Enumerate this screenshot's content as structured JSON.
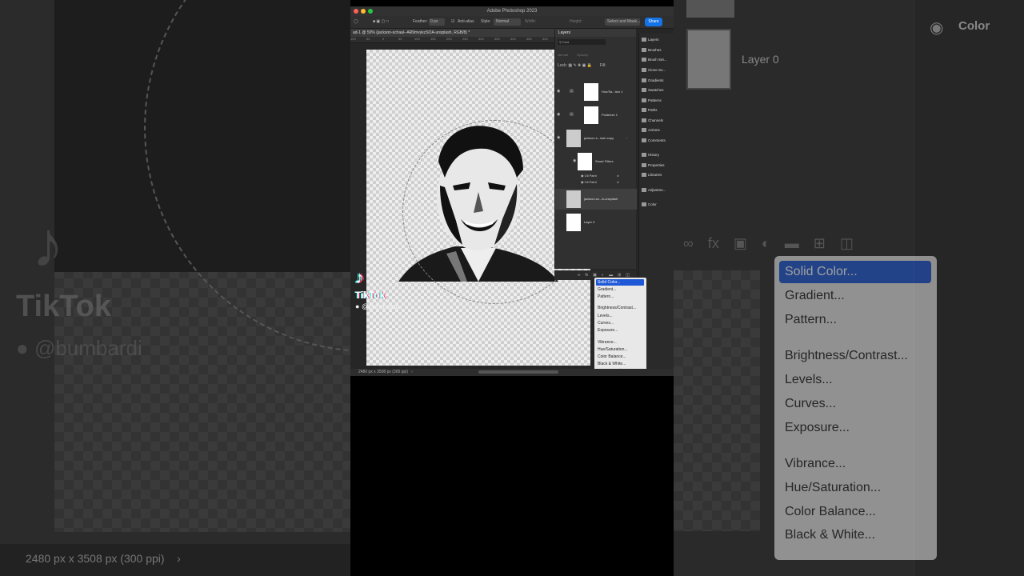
{
  "app": {
    "title": "Adobe Photoshop 2023",
    "doc_tab": "ad-1 @ 50% (jackson-schaal--AR9mvykzSOA-unsplash, RGB/8) *",
    "status": "2480 px x 3508 px (300 ppi)"
  },
  "options_bar": {
    "feather_label": "Feather:",
    "feather_value": "0 px",
    "anti_alias": "Anti-alias",
    "style_label": "Style:",
    "style_value": "Normal",
    "width_label": "Width:",
    "height_label": "Height:",
    "select_mask": "Select and Mask...",
    "share": "Share"
  },
  "ruler": [
    "100",
    "50",
    "0",
    "50",
    "100",
    "150",
    "200",
    "250",
    "300",
    "350",
    "400",
    "450",
    "500",
    "550"
  ],
  "layers_panel": {
    "title": "Layers",
    "filter": "Kind",
    "blend": "Normal",
    "opacity": "Opacity:",
    "lock": "Lock:",
    "fill": "Fill:",
    "layers": [
      {
        "name": "Hue/Sa...tion 1"
      },
      {
        "name": "Posterize 1"
      },
      {
        "name": "jackson-s...lash copy"
      },
      {
        "name": "Smart Filters"
      },
      {
        "name": "jackson-sc...A-unsplash"
      },
      {
        "name": "Layer 0"
      }
    ],
    "smart_filters": [
      "Oil Paint",
      "Oil Paint"
    ]
  },
  "side_panels": [
    "Layers",
    "Brushes",
    "Brush Set...",
    "Clone So...",
    "Gradients",
    "Swatches",
    "Patterns",
    "Paths",
    "Channels",
    "Actions",
    "Comments",
    "History",
    "Properties",
    "Libraries",
    "Adjustme...",
    "Color"
  ],
  "adjustment_menu": {
    "items": [
      "Solid Color...",
      "Gradient...",
      "Pattern...",
      "Brightness/Contrast...",
      "Levels...",
      "Curves...",
      "Exposure...",
      "Vibrance...",
      "Hue/Saturation...",
      "Color Balance...",
      "Black & White..."
    ],
    "selected": "Solid Color..."
  },
  "tiktok": {
    "name": "TikTok",
    "user": "@bumbardi"
  },
  "right_bg": {
    "layer_label": "Layer 0",
    "panel_label": "Color"
  }
}
